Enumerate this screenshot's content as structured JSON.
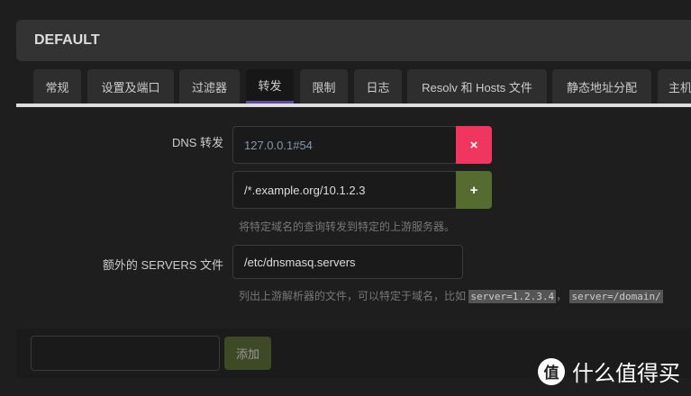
{
  "header": {
    "title": "DEFAULT"
  },
  "tabs": [
    {
      "label": "常规"
    },
    {
      "label": "设置及端口"
    },
    {
      "label": "过滤器"
    },
    {
      "label": "转发"
    },
    {
      "label": "限制"
    },
    {
      "label": "日志"
    },
    {
      "label": "Resolv 和 Hosts 文件"
    },
    {
      "label": "静态地址分配"
    },
    {
      "label": "主机"
    }
  ],
  "active_tab": "转发",
  "dns_forward": {
    "label": "DNS 转发",
    "values": [
      "127.0.0.1#54",
      "/*.example.org/10.1.2.3"
    ],
    "remove_label": "×",
    "add_label": "+",
    "hint": "将特定域名的查询转发到特定的上游服务器。"
  },
  "servers_file": {
    "label": "额外的 SERVERS 文件",
    "value": "/etc/dnsmasq.servers",
    "hint_prefix": "列出上游解析器的文件，可以特定于域名，比如",
    "code1": "server=1.2.3.4",
    "sep": "，",
    "code2": "server=/domain/"
  },
  "footer": {
    "input_value": "",
    "add_button": "添加"
  },
  "watermark": {
    "icon_text": "值",
    "text": "什么值得买"
  },
  "colors": {
    "remove": "#f0365f",
    "add": "#556b2f",
    "active_tab_underline": "#5b4a9e"
  }
}
